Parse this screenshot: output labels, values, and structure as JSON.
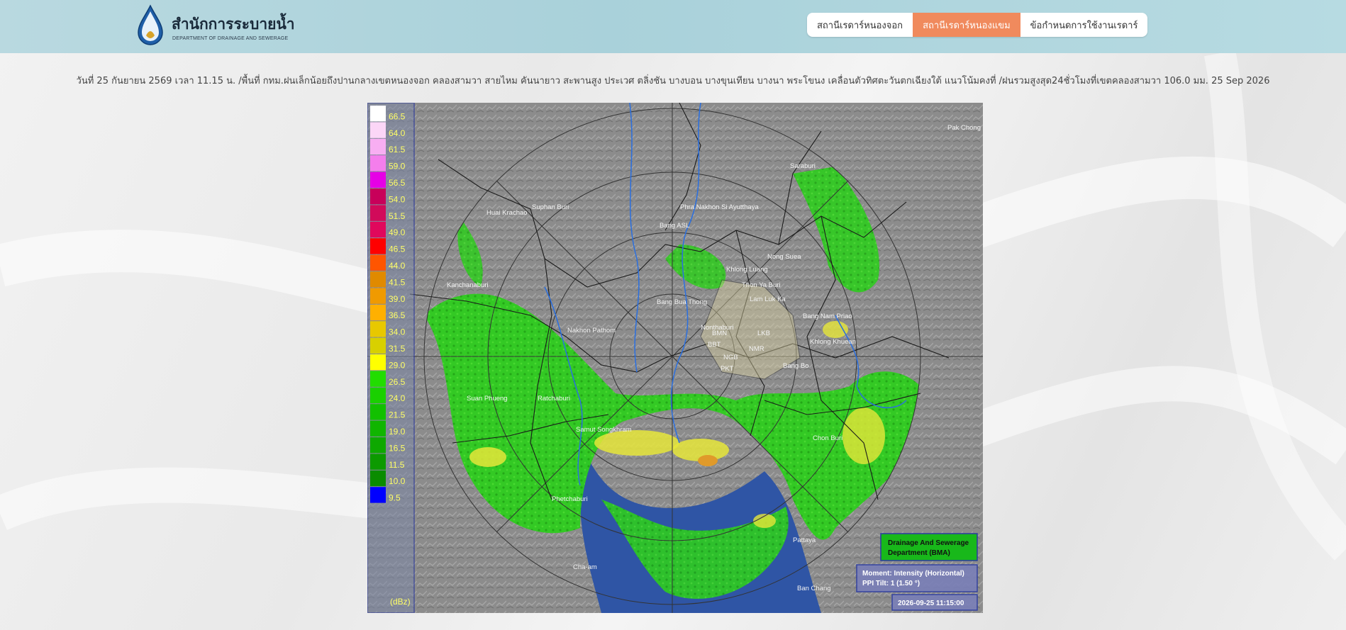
{
  "brand": {
    "title_th": "สำนักการระบายน้ำ",
    "title_en": "DEPARTMENT OF DRAINAGE AND SEWERAGE"
  },
  "nav": {
    "items": [
      {
        "label": "สถานีเรดาร์หนองจอก",
        "active": false
      },
      {
        "label": "สถานีเรดาร์หนองแขม",
        "active": true
      },
      {
        "label": "ข้อกำหนดการใช้งานเรดาร์",
        "active": false
      }
    ]
  },
  "notice": "วันที่ 25 กันยายน 2569 เวลา 11.15  น. /พื้นที่ กทม.ฝนเล็กน้อยถึงปานกลางเขตหนองจอก คลองสามวา สายไหม คันนายาว สะพานสูง ประเวศ ตลิ่งชัน บางบอน บางขุนเทียน บางนา พระโขนง  เคลื่อนตัวทิศตะวันตกเฉียงใต้ แนวโน้มคงที่ /ฝนรวมสูงสุด24ชั่วโมงที่เขตคลองสามวา 106.0 มม. 25 Sep 2026",
  "radar": {
    "legend_values": [
      "66.5",
      "64.0",
      "61.5",
      "59.0",
      "56.5",
      "54.0",
      "51.5",
      "49.0",
      "46.5",
      "44.0",
      "41.5",
      "39.0",
      "36.5",
      "34.0",
      "31.5",
      "29.0",
      "26.5",
      "24.0",
      "21.5",
      "19.0",
      "16.5",
      "11.5",
      "10.0",
      "9.5"
    ],
    "legend_unit": "(dBz)",
    "legend_colors": [
      "#ffffff",
      "#fbd6f7",
      "#f8aef2",
      "#f47eec",
      "#e600e6",
      "#c8005a",
      "#d10a5a",
      "#e0085c",
      "#ff0000",
      "#ff5500",
      "#e08a00",
      "#f09a00",
      "#ffb000",
      "#e8c800",
      "#d8d000",
      "#ffff00",
      "#22dd00",
      "#1ad000",
      "#12c000",
      "#10b500",
      "#0ea800",
      "#0c9a00",
      "#0a8c00",
      "#0000ff"
    ],
    "places": [
      "Pak Chong",
      "Suphan Buri",
      "Saraburi",
      "Huai Krachao",
      "Phra Nakhon Si Ayutthaya",
      "Bang ASL",
      "Nong Suea",
      "Kanchanaburi",
      "Khlong Luang",
      "Thon Ya Buri",
      "Lam Luk Ka",
      "Bang Nam Priao",
      "Nakhon Pathom",
      "Nonthaburi",
      "Bang Bua Thong",
      "Khlong Khuean",
      "Bang Bo",
      "Suan Phueng",
      "Ratchaburi",
      "Samut Songkhram",
      "Chon Buri",
      "Phetchaburi",
      "Pattaya",
      "Cha-am",
      "Ban Chang",
      "LKB",
      "NMR",
      "BBT",
      "BMN",
      "PKT",
      "NGB"
    ],
    "dept_label": "Drainage And Sewerage Department (BMA)",
    "moment_label": "Moment: Intensity (Horizontal)",
    "tilt_label": "PPI Tilt: 1 (1.50 °)",
    "timestamp": "2026-09-25 11:15:00",
    "colors": {
      "land": "#8a8a8a",
      "sea": "#2f55a5",
      "rain": "#2ecc1e",
      "heavy": "#e6e63a",
      "intense": "#e09a2a",
      "accent": "#f08a5d"
    }
  }
}
